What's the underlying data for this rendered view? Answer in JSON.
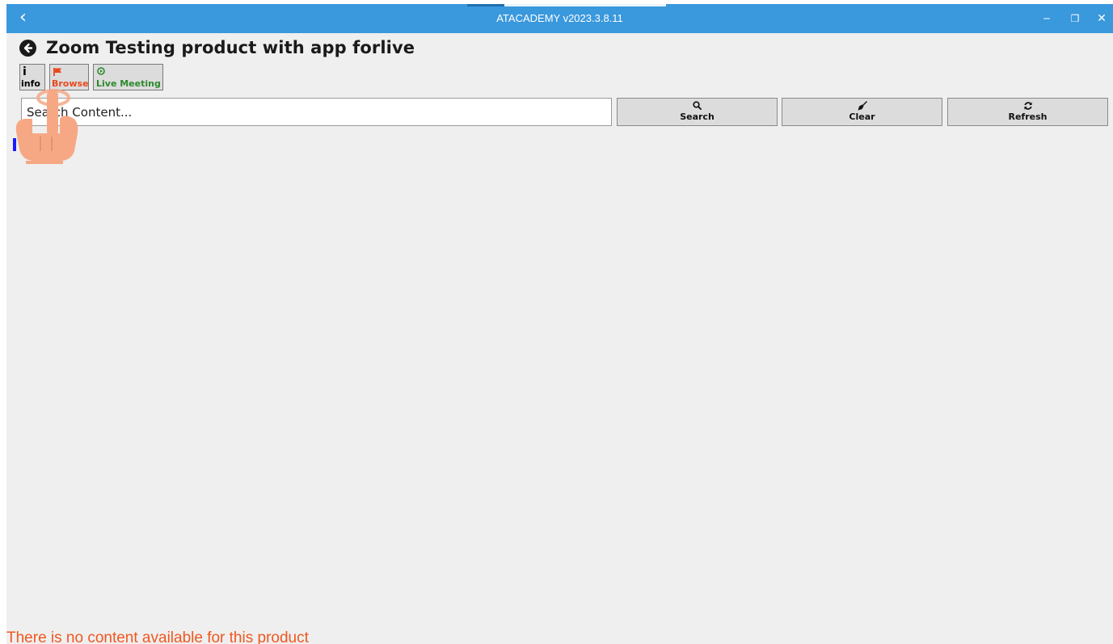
{
  "window": {
    "title": "ATACADEMY v2023.3.8.11",
    "back_glyph": "‹",
    "min_glyph": "‒",
    "max_glyph": "❐",
    "close_glyph": "✕"
  },
  "page": {
    "title": "Zoom Testing product with app forlive"
  },
  "toolbar": {
    "info_icon": "i",
    "info_label": "info",
    "browse_label": "Browse",
    "live_label": "Live Meeting"
  },
  "search": {
    "placeholder": "Search Content...",
    "value": ""
  },
  "actions": {
    "search_label": "Search",
    "clear_label": "Clear",
    "refresh_label": "Refresh"
  },
  "status": {
    "empty_message": "There is no content available for this product"
  },
  "colors": {
    "titlebar": "#3a98dc",
    "background": "#efefef",
    "browse_accent": "#e8491d",
    "live_accent": "#2c8a2c",
    "empty_message": "#f0571f",
    "hand_overlay": "#f6a885"
  },
  "icons": {
    "back": "arrow-left-circle-icon",
    "info": "info-icon",
    "browse": "flag-icon",
    "live": "play-circle-icon",
    "search": "magnifier-icon",
    "clear": "broom-icon",
    "refresh": "refresh-icon",
    "pointer": "hand-pointer-icon"
  }
}
